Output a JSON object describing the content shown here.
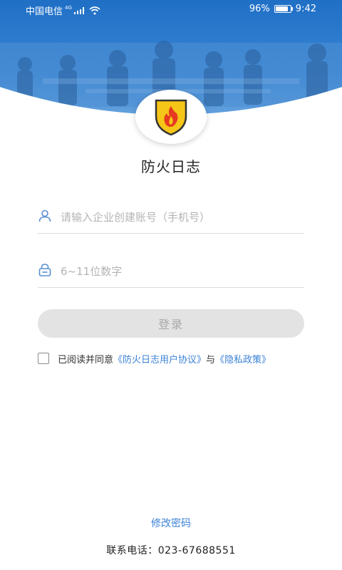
{
  "status_bar": {
    "carrier": "中国电信",
    "network": "4G",
    "battery": "96%",
    "battery_level": 0.96,
    "time": "9:42"
  },
  "app": {
    "title": "防火日志",
    "logo_icon": "fire-shield-icon"
  },
  "form": {
    "account_placeholder": "请输入企业创建账号（手机号）",
    "account_icon": "user-icon",
    "password_placeholder": "6~11位数字",
    "password_icon": "lock-icon",
    "login_label": "登录"
  },
  "agreement": {
    "prefix": "已阅读并同意",
    "user_agreement": "《防火日志用户协议》",
    "conjunction": "与",
    "privacy_policy": "《隐私政策》",
    "checked": false
  },
  "footer": {
    "change_password": "修改密码",
    "contact": "联系电话：023-67688551"
  },
  "colors": {
    "header_blue": "#2b78c9",
    "link_blue": "#3b82d6",
    "button_disabled": "#e3e3e3",
    "shield_yellow": "#f5c518",
    "flame_red": "#e53921"
  }
}
